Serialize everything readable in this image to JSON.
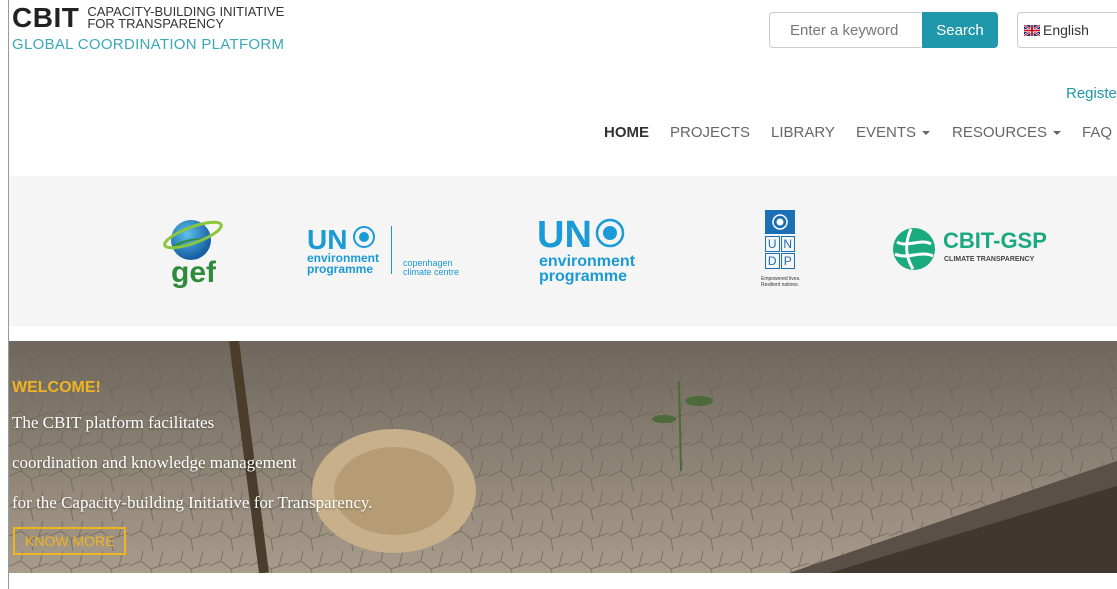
{
  "header": {
    "logo_main": "CBIT",
    "logo_tag_line1": "CAPACITY-BUILDING INITIATIVE",
    "logo_tag_line2": "FOR TRANSPARENCY",
    "logo_subtitle": "GLOBAL COORDINATION PLATFORM"
  },
  "search": {
    "placeholder": "Enter a keyword",
    "button_label": "Search"
  },
  "language": {
    "selected": "English",
    "flag_icon": "uk-flag-icon"
  },
  "register_label": "Registe",
  "nav": {
    "home": "HOME",
    "projects": "PROJECTS",
    "library": "LIBRARY",
    "events": "EVENTS",
    "resources": "RESOURCES",
    "faq": "FAQ"
  },
  "partners": {
    "gef": "gef",
    "unep_ccc_un": "UN",
    "unep_ccc_env": "environment",
    "unep_ccc_prog": "programme",
    "unep_ccc_cph1": "copenhagen",
    "unep_ccc_cph2": "climate centre",
    "unep_un": "UN",
    "unep_env": "environment",
    "unep_prog": "programme",
    "undp_letters": [
      "U",
      "N",
      "D",
      "P"
    ],
    "undp_tag1": "Empowered lives.",
    "undp_tag2": "Resilient nations.",
    "cbit_gsp": "CBIT-GSP",
    "cbit_gsp_sub": "CLIMATE TRANSPARENCY"
  },
  "hero": {
    "welcome": "WELCOME!",
    "line1": "The CBIT platform facilitates",
    "line2": "coordination and knowledge management",
    "line3": "for the Capacity-building Initiative for Transparency.",
    "button_label": "KNOW MORE"
  },
  "colors": {
    "accent": "#1f98ab",
    "gold": "#f0b323",
    "un_blue": "#1a9ad6",
    "gsp_green": "#1aaa7c"
  }
}
